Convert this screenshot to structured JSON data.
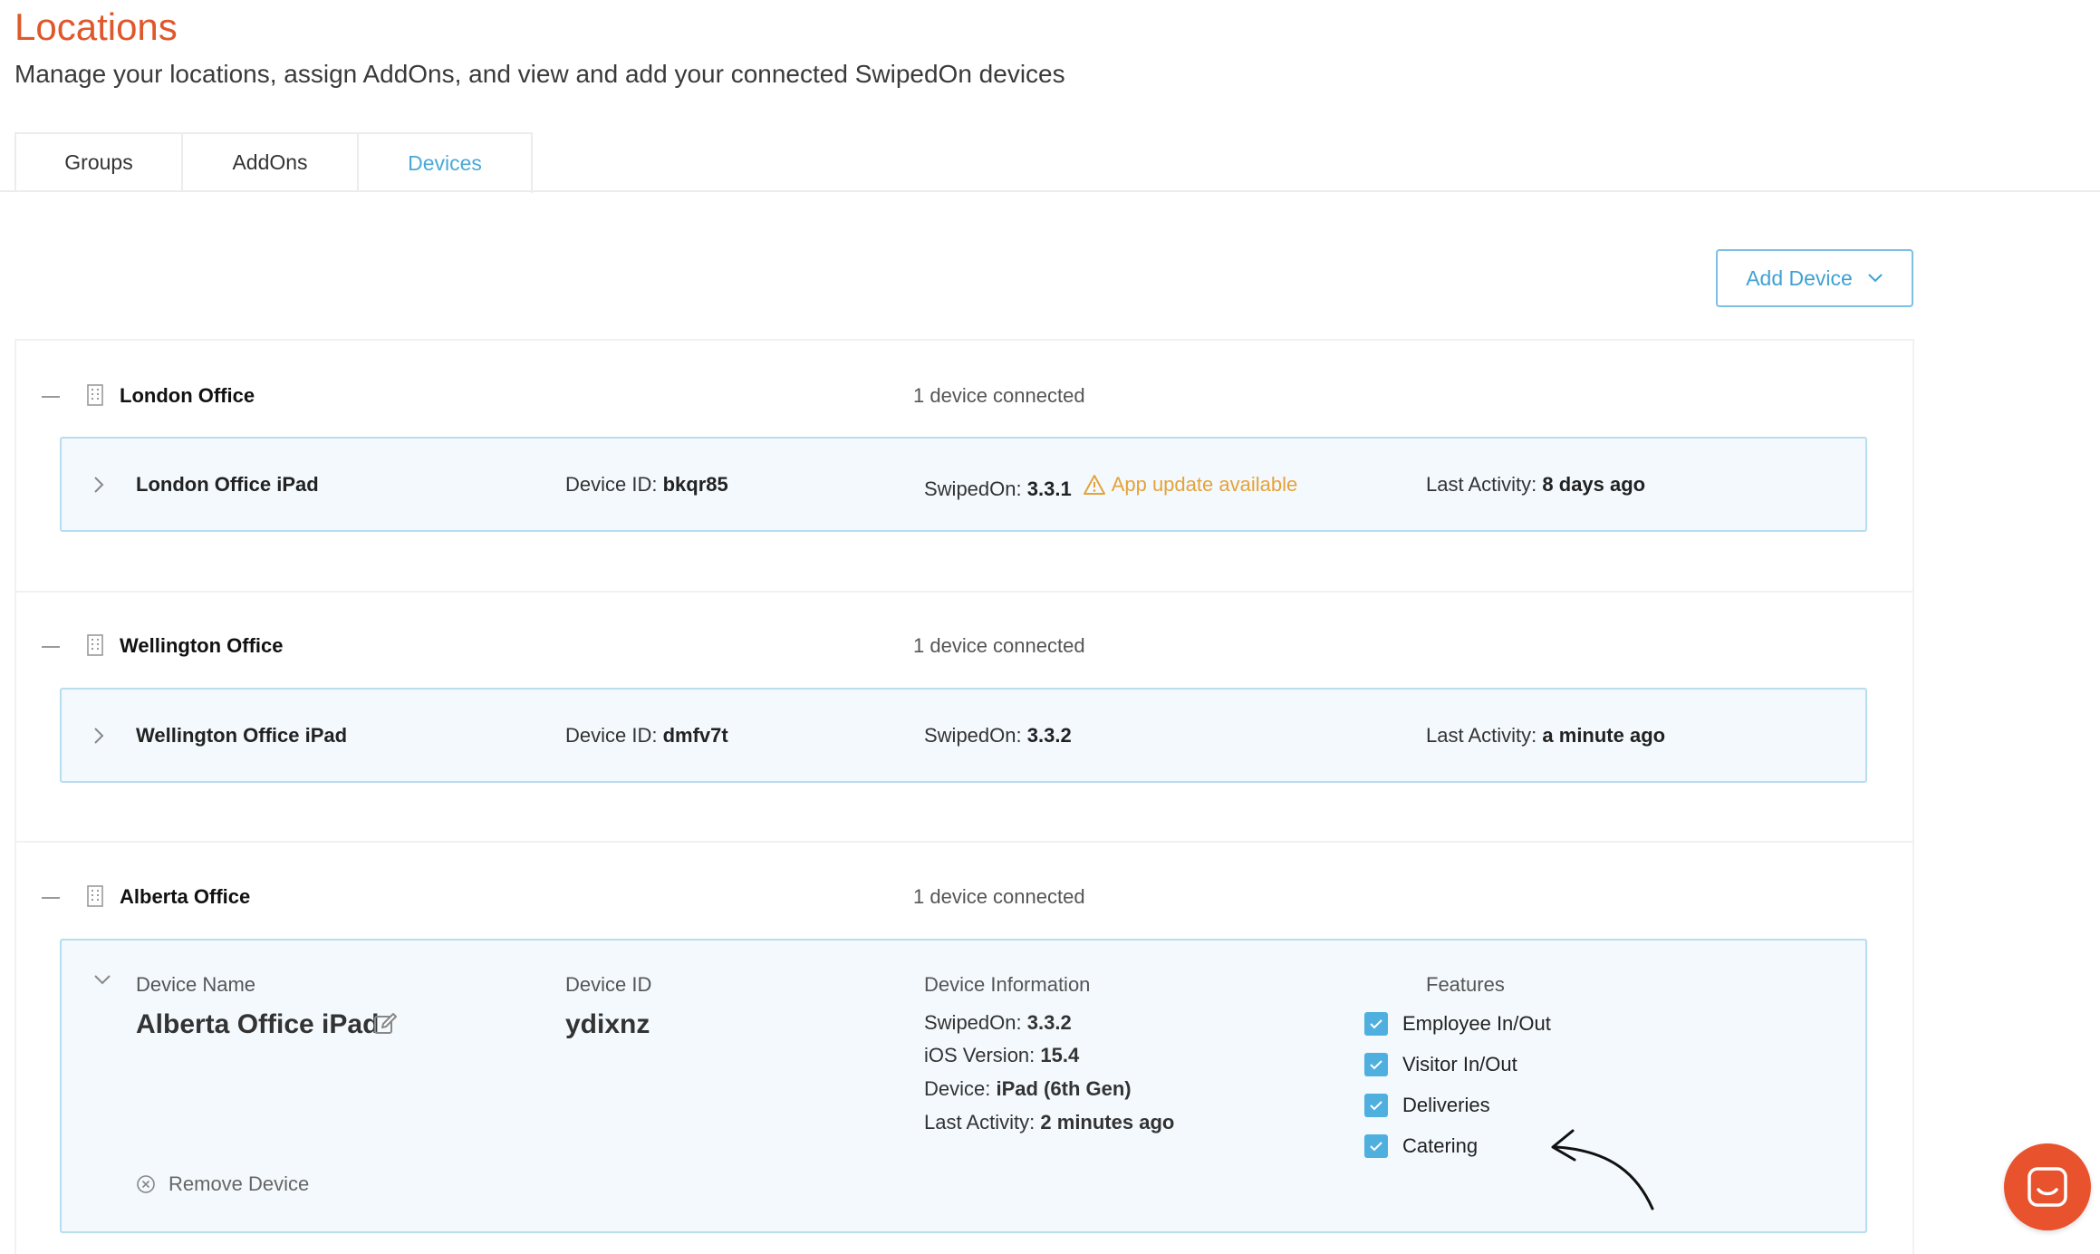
{
  "header": {
    "title": "Locations",
    "subtitle": "Manage your locations, assign AddOns, and view and add your connected SwipedOn devices"
  },
  "tabs": [
    {
      "label": "Groups",
      "active": false
    },
    {
      "label": "AddOns",
      "active": false
    },
    {
      "label": "Devices",
      "active": true
    }
  ],
  "toolbar": {
    "add_device_label": "Add Device"
  },
  "groups": [
    {
      "name": "London Office",
      "count_label": "1 device connected",
      "device": {
        "name": "London Office iPad",
        "device_id_label": "Device ID:",
        "device_id": "bkqr85",
        "swipedon_label": "SwipedOn:",
        "swipedon_version": "3.3.1",
        "warning": "App update available",
        "last_activity_label": "Last Activity:",
        "last_activity": "8 days ago"
      }
    },
    {
      "name": "Wellington Office",
      "count_label": "1 device connected",
      "device": {
        "name": "Wellington Office iPad",
        "device_id_label": "Device ID:",
        "device_id": "dmfv7t",
        "swipedon_label": "SwipedOn:",
        "swipedon_version": "3.3.2",
        "last_activity_label": "Last Activity:",
        "last_activity": "a minute ago"
      }
    },
    {
      "name": "Alberta Office",
      "count_label": "1 device connected",
      "device": {
        "name_heading": "Device Name",
        "name": "Alberta Office iPad",
        "id_heading": "Device ID",
        "device_id": "ydixnz",
        "info_heading": "Device Information",
        "swipedon_label": "SwipedOn:",
        "swipedon_version": "3.3.2",
        "ios_label": "iOS Version:",
        "ios_version": "15.4",
        "device_label": "Device:",
        "device_model": "iPad (6th Gen)",
        "last_activity_label": "Last Activity:",
        "last_activity": "2 minutes ago",
        "features_heading": "Features",
        "features": [
          {
            "label": "Employee In/Out",
            "checked": true
          },
          {
            "label": "Visitor In/Out",
            "checked": true
          },
          {
            "label": "Deliveries",
            "checked": true
          },
          {
            "label": "Catering",
            "checked": true
          }
        ],
        "remove_label": "Remove Device"
      }
    }
  ],
  "colors": {
    "brand": "#e0572b",
    "accent": "#4aa9d6",
    "warning": "#e6a23a",
    "checkbox": "#4fb0e0"
  },
  "icons": {
    "group": "building-icon",
    "expand": "chevron-right-icon",
    "collapse": "chevron-down-icon",
    "edit": "edit-icon",
    "remove": "close-circle-icon",
    "warning": "warning-icon",
    "chat": "chat-icon"
  }
}
